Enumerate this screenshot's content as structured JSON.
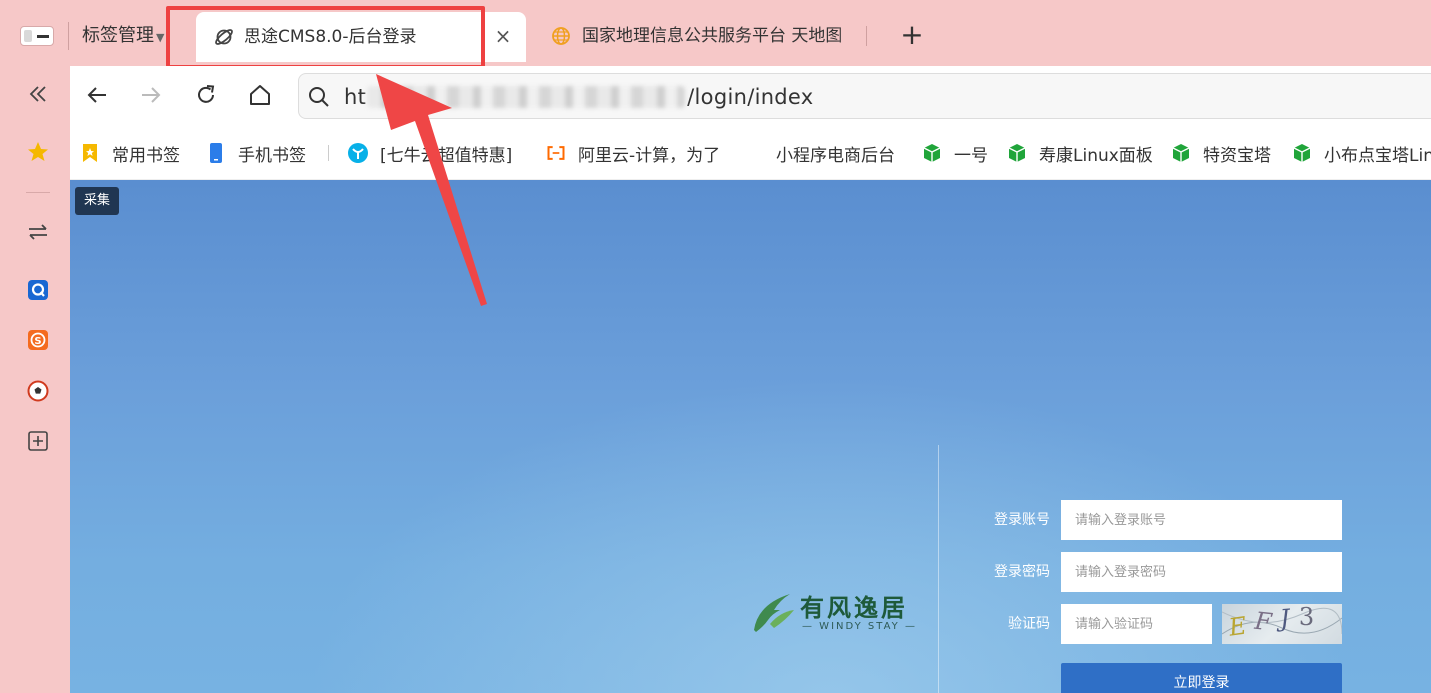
{
  "tabs": {
    "tab_manager_label": "标签管理",
    "active": {
      "title": "思途CMS8.0-后台登录",
      "close": "×"
    },
    "second": {
      "title": "国家地理信息公共服务平台 天地图"
    },
    "new_tab": "+"
  },
  "toolbar": {
    "url_prefix": "ht",
    "url_suffix": "/login/index"
  },
  "bookmarks": [
    {
      "label": "常用书签"
    },
    {
      "label": "手机书签"
    },
    {
      "label": "[七牛云超值特惠]"
    },
    {
      "label": "阿里云-计算，为了"
    },
    {
      "label": "小程序电商后台"
    },
    {
      "label": "一号"
    },
    {
      "label": "寿康Linux面板"
    },
    {
      "label": "特资宝塔"
    },
    {
      "label": "小布点宝塔Linux"
    }
  ],
  "page": {
    "collect_tag": "采集",
    "brand": {
      "name": "有风逸居",
      "sub": "— WINDY STAY —"
    },
    "form": {
      "account_label": "登录账号",
      "account_placeholder": "请输入登录账号",
      "password_label": "登录密码",
      "password_placeholder": "请输入登录密码",
      "captcha_label": "验证码",
      "captcha_placeholder": "请输入验证码",
      "captcha_chars": [
        "E",
        "F",
        "J",
        "3"
      ],
      "login_button": "立即登录"
    }
  },
  "colors": {
    "tabstrip": "#f6c8c8",
    "highlight": "#ee4141",
    "login_button": "#2f6fc6",
    "brand_green": "#1e5a3a"
  },
  "icons": {
    "sidebar": [
      "collapse-sidebar-icon",
      "favorites-star-icon",
      "transfer-icon",
      "q-app-icon",
      "s-app-icon",
      "football-icon",
      "add-app-icon"
    ]
  }
}
